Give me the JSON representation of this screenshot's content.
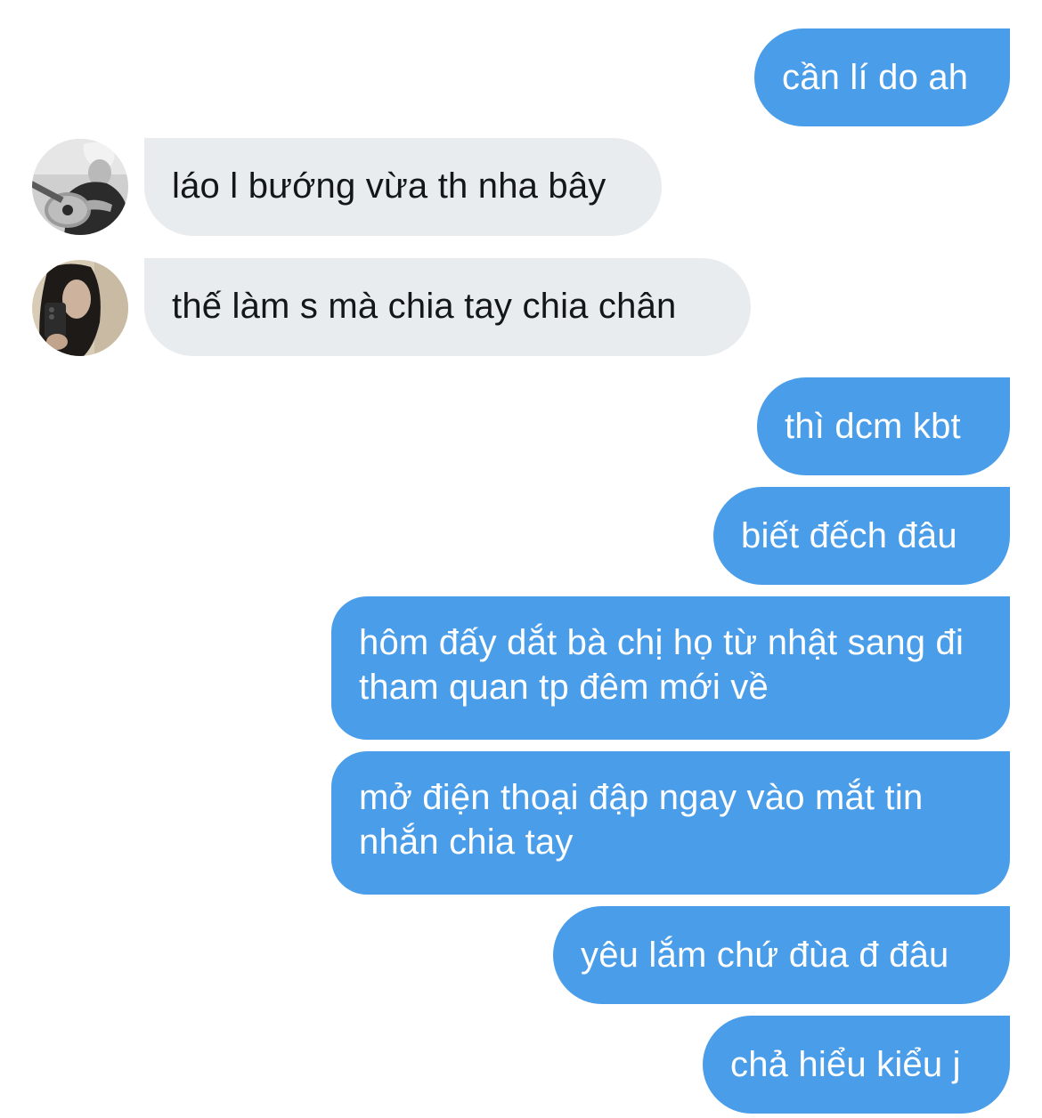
{
  "conversation": {
    "messages": [
      {
        "direction": "outgoing",
        "text": "cần lí do ah"
      },
      {
        "direction": "incoming",
        "avatar_icon": "user-avatar-guitar-icon",
        "text": "láo l bướng vừa th nha bây"
      },
      {
        "direction": "incoming",
        "avatar_icon": "user-avatar-selfie-icon",
        "text": "thế làm s mà chia tay chia chân"
      },
      {
        "direction": "outgoing",
        "text": "thì dcm kbt"
      },
      {
        "direction": "outgoing",
        "text": "biết đếch đâu"
      },
      {
        "direction": "outgoing",
        "text": "hôm đấy dắt bà chị họ từ nhật sang đi tham quan tp đêm mới về"
      },
      {
        "direction": "outgoing",
        "text": "mở điện thoại đập ngay vào mắt tin nhắn chia tay"
      },
      {
        "direction": "outgoing",
        "text": "yêu lắm chứ đùa đ đâu"
      },
      {
        "direction": "outgoing",
        "text": "chả hiểu kiểu j"
      }
    ]
  },
  "colors": {
    "outgoing_bubble": "#4a9de9",
    "outgoing_text": "#ffffff",
    "incoming_bubble": "#e9ecef",
    "incoming_text": "#14171a",
    "background": "#ffffff"
  }
}
